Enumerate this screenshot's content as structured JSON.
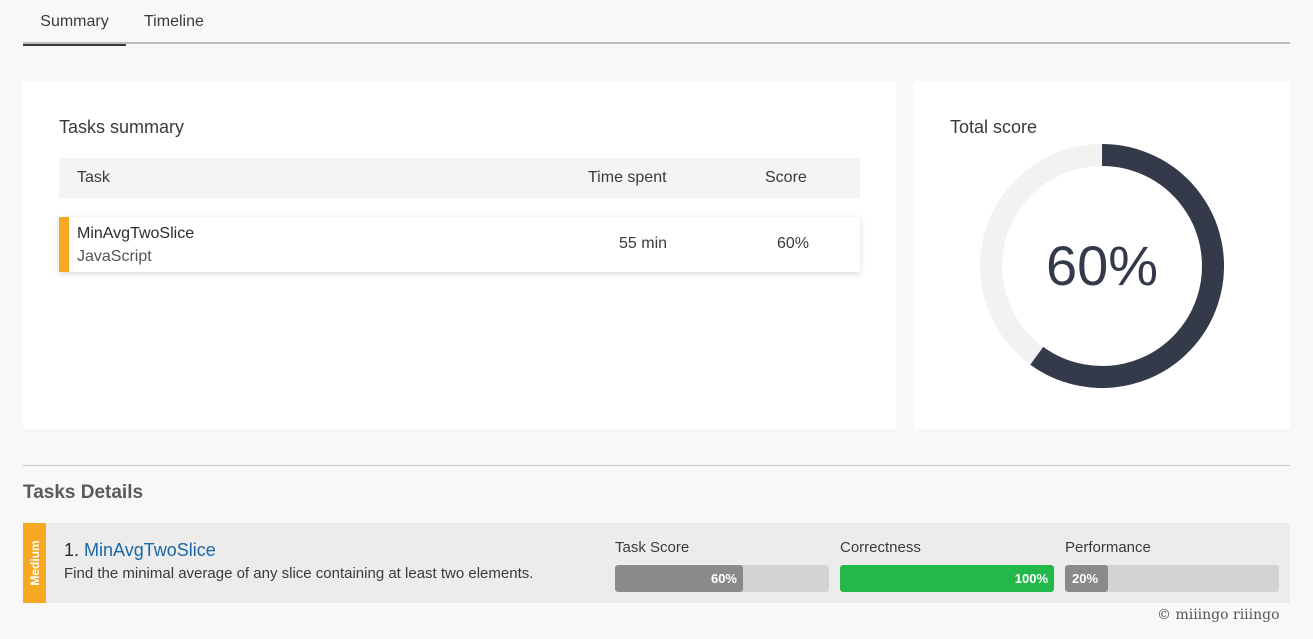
{
  "tabs": [
    {
      "label": "Summary",
      "active": true
    },
    {
      "label": "Timeline",
      "active": false
    }
  ],
  "summary": {
    "title": "Tasks summary",
    "columns": [
      "Task",
      "Time spent",
      "Score"
    ],
    "rows": [
      {
        "name": "MinAvgTwoSlice",
        "language": "JavaScript",
        "time": "55 min",
        "score": "60%",
        "difficulty_color": "#f6a821"
      }
    ]
  },
  "total_score": {
    "title": "Total score",
    "value": 60,
    "label": "60%",
    "colors": {
      "fill": "#343a4a",
      "track": "#f2f2f2"
    }
  },
  "details": {
    "title": "Tasks Details",
    "items": [
      {
        "difficulty": "Medium",
        "number": "1.",
        "name": "MinAvgTwoSlice",
        "description": "Find the minimal average of any slice containing at least two elements.",
        "metrics": [
          {
            "label": "Task Score",
            "value": 60,
            "text": "60%",
            "color": "#8a8a8a"
          },
          {
            "label": "Correctness",
            "value": 100,
            "text": "100%",
            "color": "#22b84a"
          },
          {
            "label": "Performance",
            "value": 20,
            "text": "20%",
            "color": "#8a8a8a"
          }
        ]
      }
    ]
  },
  "watermark": "© miiingo riiingo"
}
